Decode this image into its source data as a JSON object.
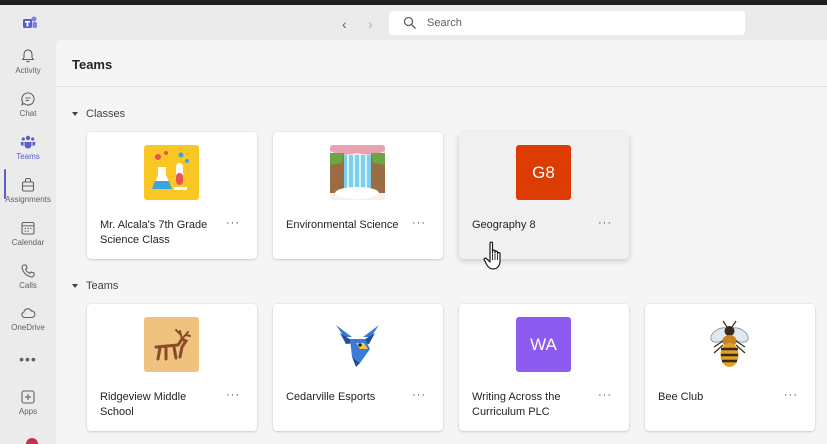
{
  "search": {
    "placeholder": "Search"
  },
  "rail": {
    "items": [
      {
        "label": "Activity",
        "icon": "bell-icon"
      },
      {
        "label": "Chat",
        "icon": "chat-icon"
      },
      {
        "label": "Teams",
        "icon": "teams-icon",
        "active": true
      },
      {
        "label": "Assignments",
        "icon": "assignments-icon"
      },
      {
        "label": "Calendar",
        "icon": "calendar-icon"
      },
      {
        "label": "Calls",
        "icon": "phone-icon"
      },
      {
        "label": "OneDrive",
        "icon": "cloud-icon"
      }
    ],
    "more_label": "•••",
    "apps_label": "Apps"
  },
  "main": {
    "title": "Teams",
    "classes_section": {
      "label": "Classes",
      "cards": [
        {
          "name": "Mr. Alcala's 7th Grade Science Class",
          "avatar": "science-flask-icon",
          "color": "#f9c623"
        },
        {
          "name": "Environmental Science",
          "avatar": "waterfall-icon",
          "color": "#8fd3e8"
        },
        {
          "name": "Geography 8",
          "initials": "G8",
          "color": "#dc3b01"
        }
      ]
    },
    "teams_section": {
      "label": "Teams",
      "cards": [
        {
          "name": "Ridgeview Middle School",
          "avatar": "cave-deer-icon",
          "color": "#efc27e"
        },
        {
          "name": "Cedarville Esports",
          "avatar": "eagle-mascot-icon",
          "color": "#3a7bd5"
        },
        {
          "name": "Writing Across the Curriculum PLC",
          "initials": "WA",
          "color": "#8c5cf0"
        },
        {
          "name": "Bee Club",
          "avatar": "bee-icon",
          "color": "#e0a12a"
        }
      ]
    },
    "more_options_label": "···"
  },
  "colors": {
    "accent": "#5b5fc7",
    "background": "#f5f5f5",
    "card": "#ffffff"
  }
}
